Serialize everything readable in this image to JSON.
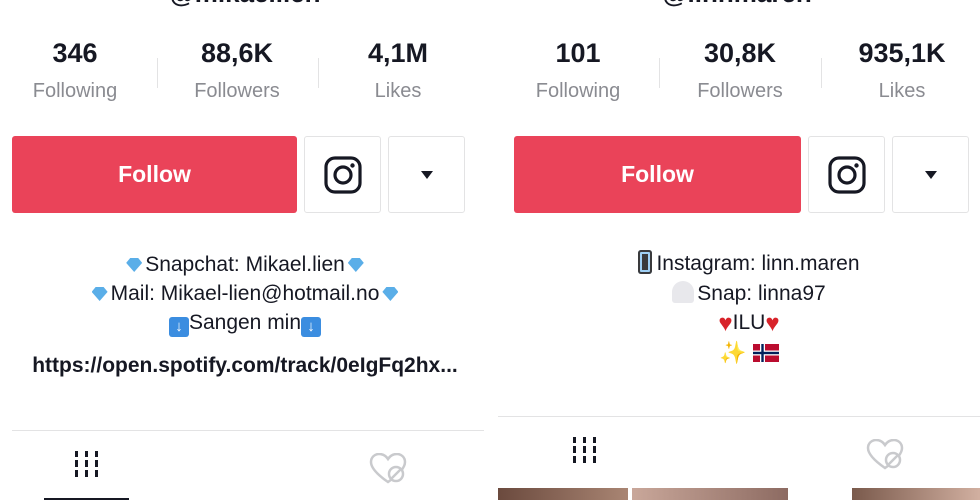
{
  "profiles": [
    {
      "username": "@mikaellien",
      "stats": [
        {
          "value": "346",
          "label": "Following"
        },
        {
          "value": "88,6K",
          "label": "Followers"
        },
        {
          "value": "4,1M",
          "label": "Likes"
        }
      ],
      "follow_label": "Follow",
      "bio": {
        "line1": "Snapchat: Mikael.lien",
        "line2": "Mail: Mikael-lien@hotmail.no",
        "line3": "Sangen min"
      },
      "link": "https://open.spotify.com/track/0eIgFq2hx..."
    },
    {
      "username": "@linnmaren",
      "stats": [
        {
          "value": "101",
          "label": "Following"
        },
        {
          "value": "30,8K",
          "label": "Followers"
        },
        {
          "value": "935,1K",
          "label": "Likes"
        }
      ],
      "follow_label": "Follow",
      "bio": {
        "line1": "Instagram: linn.maren",
        "line2": "Snap: linna97",
        "line3": "ILU"
      }
    }
  ],
  "colors": {
    "follow": "#ea4359",
    "text": "#161823",
    "muted": "#8a8b91",
    "border": "#e3e3e4"
  },
  "icons": [
    "instagram-icon",
    "caret-down-icon",
    "videos-grid-icon",
    "liked-heart-icon",
    "diamond-emoji",
    "down-arrow-emoji",
    "phone-emoji",
    "ghost-emoji",
    "heart-emoji",
    "sparkles-emoji",
    "norway-flag-emoji"
  ]
}
